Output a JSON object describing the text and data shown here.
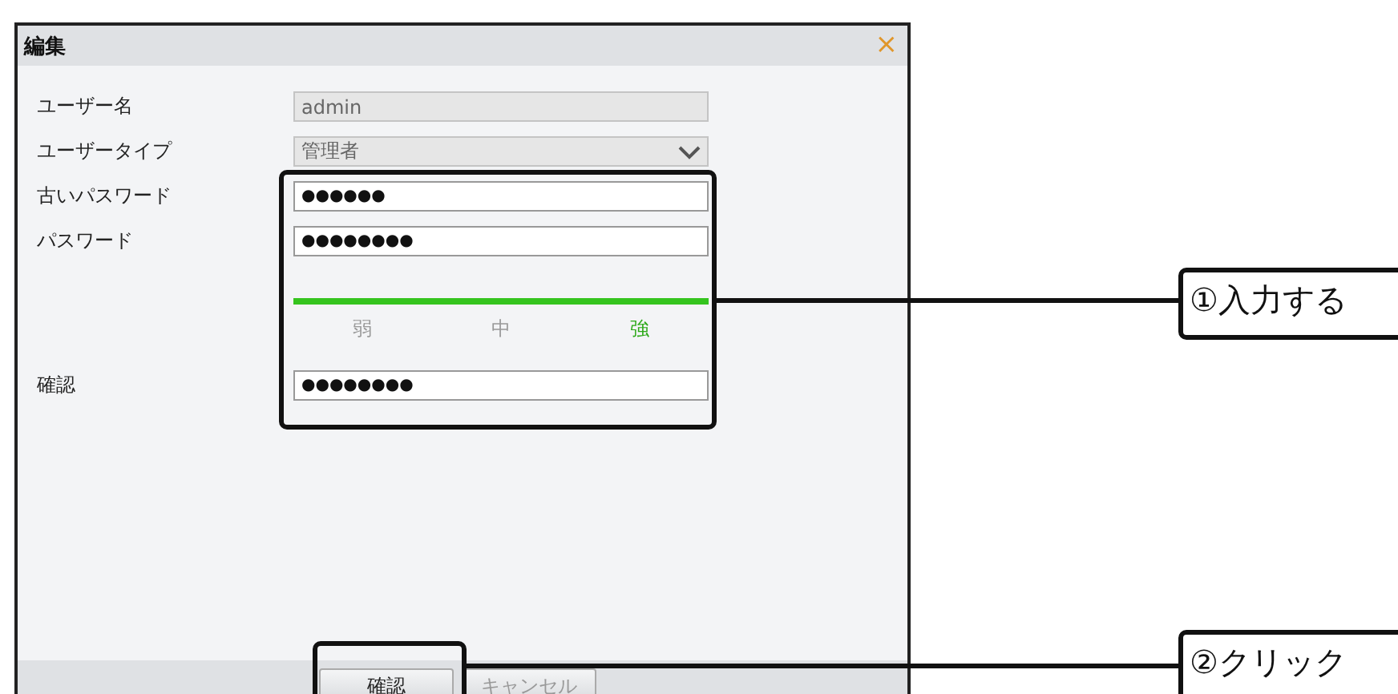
{
  "window": {
    "title": "編集",
    "close": "×"
  },
  "fields": [
    {
      "label": "ユーザー名",
      "kind": "text",
      "value": "admin",
      "disabled": true
    },
    {
      "label": "ユーザータイプ",
      "kind": "select",
      "value": "管理者",
      "disabled": true
    },
    {
      "label": "古いパスワード",
      "kind": "password",
      "value": "●●●●●●",
      "disabled": false
    },
    {
      "label": "パスワード",
      "kind": "password",
      "value": "●●●●●●●●",
      "disabled": false
    },
    {
      "kind": "strength",
      "level": 1,
      "labels": [
        {
          "text": "弱",
          "selected": false
        },
        {
          "text": "中",
          "selected": false
        },
        {
          "text": "強",
          "selected": true
        }
      ]
    },
    {
      "label": "確認",
      "kind": "password",
      "value": "●●●●●●●●",
      "disabled": false
    }
  ],
  "buttons": [
    {
      "label": "確認"
    },
    {
      "label": "キャンセル"
    }
  ],
  "annotations": [
    {
      "text": "①入力する"
    },
    {
      "text": "②クリック"
    }
  ]
}
